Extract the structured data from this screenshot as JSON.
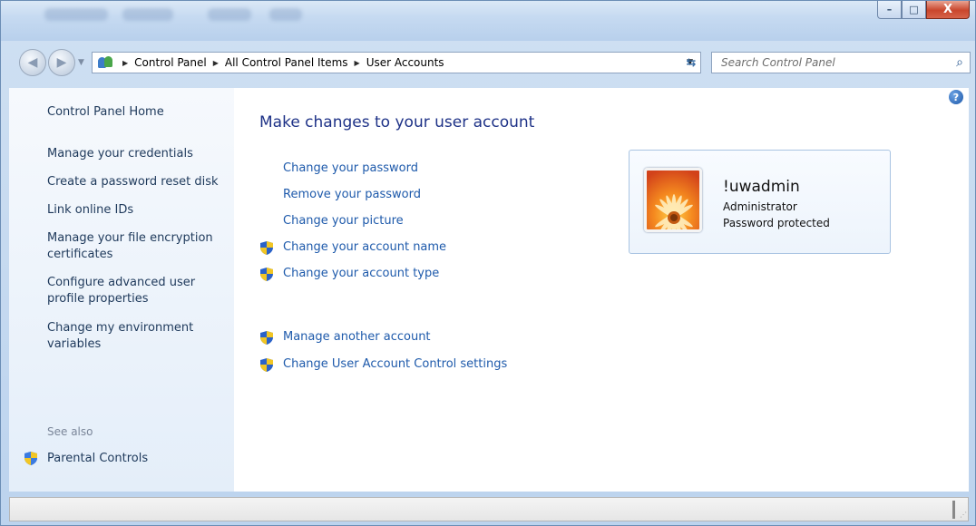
{
  "window": {
    "caption": {
      "minimize": "–",
      "maximize": "□",
      "close": "X"
    }
  },
  "navbar": {
    "breadcrumbs": [
      "Control Panel",
      "All Control Panel Items",
      "User Accounts"
    ],
    "search_placeholder": "Search Control Panel"
  },
  "sidebar": {
    "home": "Control Panel Home",
    "items": [
      "Manage your credentials",
      "Create a password reset disk",
      "Link online IDs",
      "Manage your file encryption certificates",
      "Configure advanced user profile properties",
      "Change my environment variables"
    ],
    "see_also_label": "See also",
    "see_also_items": [
      "Parental Controls"
    ]
  },
  "main": {
    "heading": "Make changes to your user account",
    "tasks": [
      "Change your password",
      "Remove your password",
      "Change your picture",
      "Change your account name",
      "Change your account type"
    ],
    "other_tasks": [
      "Manage another account",
      "Change User Account Control settings"
    ]
  },
  "user": {
    "name": "!uwadmin",
    "role": "Administrator",
    "status": "Password protected"
  },
  "colors": {
    "link": "#1e5aab",
    "heading": "#1e3287",
    "sidebar_text": "#1e395b"
  }
}
